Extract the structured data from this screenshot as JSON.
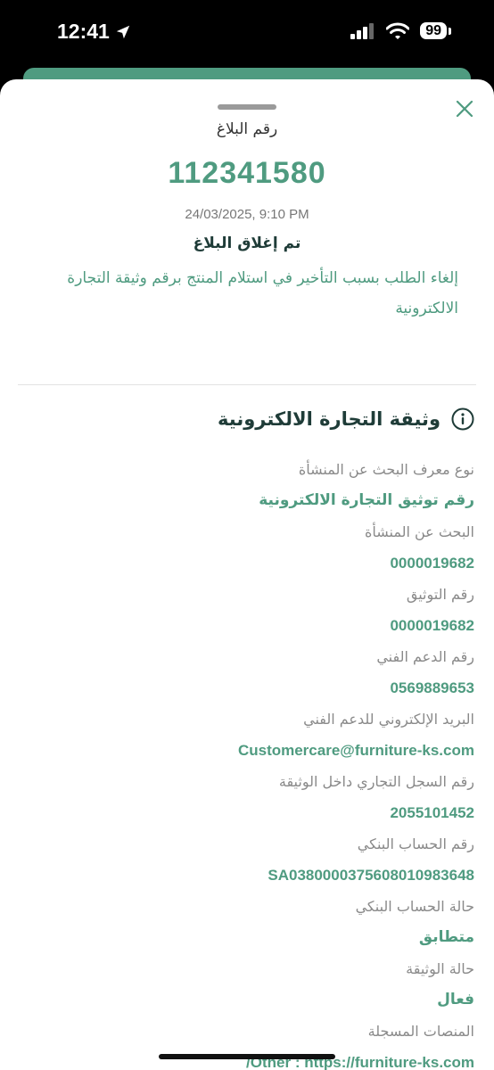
{
  "status_bar": {
    "time": "12:41",
    "battery": "99"
  },
  "ticket": {
    "label": "رقم البلاغ",
    "number": "112341580",
    "date": "24/03/2025, 9:10 PM",
    "status": "تم إغلاق البلاغ",
    "description": "إلغاء الطلب بسبب التأخير في استلام المنتج برقم وثيقة التجارة الالكترونية"
  },
  "document": {
    "title": "وثيقة التجارة الالكترونية",
    "fields": [
      {
        "label": "نوع معرف البحث عن المنشأة",
        "value": "رقم توثيق التجارة الالكترونية"
      },
      {
        "label": "البحث عن المنشأة",
        "value": "0000019682"
      },
      {
        "label": "رقم التوثيق",
        "value": "0000019682"
      },
      {
        "label": "رقم الدعم الفني",
        "value": "0569889653"
      },
      {
        "label": "البريد الإلكتروني للدعم الفني",
        "value": "Customercare@furniture-ks.com"
      },
      {
        "label": "رقم السجل التجاري داخل الوثيقة",
        "value": "2055101452"
      },
      {
        "label": "رقم الحساب البنكي",
        "value": "SA0380000375608010983648"
      },
      {
        "label": "حالة الحساب البنكي",
        "value": "متطابق"
      },
      {
        "label": "حالة الوثيقة",
        "value": "فعال"
      },
      {
        "label": "المنصات المسجلة",
        "value": "Other : https://furniture-ks.com/"
      }
    ]
  },
  "colors": {
    "accent": "#4f9b80",
    "dark_text": "#1f3c38",
    "muted": "#8a8a8a"
  }
}
